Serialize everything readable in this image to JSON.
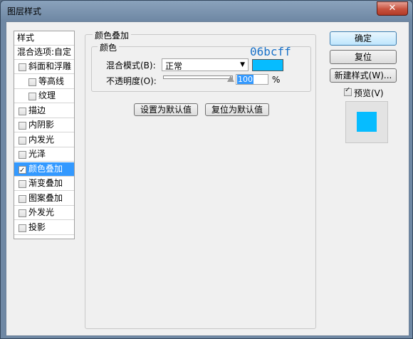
{
  "window": {
    "title": "图层样式",
    "close_label": "✕"
  },
  "style_list": {
    "header": "样式",
    "blend_options": "混合选项:自定",
    "items": [
      {
        "label": "斜面和浮雕",
        "checked": false,
        "selected": false,
        "indent": false
      },
      {
        "label": "等高线",
        "checked": false,
        "selected": false,
        "indent": true
      },
      {
        "label": "纹理",
        "checked": false,
        "selected": false,
        "indent": true
      },
      {
        "label": "描边",
        "checked": false,
        "selected": false,
        "indent": false
      },
      {
        "label": "内阴影",
        "checked": false,
        "selected": false,
        "indent": false
      },
      {
        "label": "内发光",
        "checked": false,
        "selected": false,
        "indent": false
      },
      {
        "label": "光泽",
        "checked": false,
        "selected": false,
        "indent": false
      },
      {
        "label": "颜色叠加",
        "checked": true,
        "selected": true,
        "indent": false
      },
      {
        "label": "渐变叠加",
        "checked": false,
        "selected": false,
        "indent": false
      },
      {
        "label": "图案叠加",
        "checked": false,
        "selected": false,
        "indent": false
      },
      {
        "label": "外发光",
        "checked": false,
        "selected": false,
        "indent": false
      },
      {
        "label": "投影",
        "checked": false,
        "selected": false,
        "indent": false
      }
    ]
  },
  "panel": {
    "title": "颜色叠加",
    "group_title": "颜色",
    "blend_mode_label": "混合模式(B):",
    "blend_mode_value": "正常",
    "opacity_label": "不透明度(O):",
    "opacity_value": "100",
    "opacity_unit": "%",
    "opacity_fraction": 1.0,
    "color_hex_annotation": "06bcff",
    "color": "#06bcff",
    "make_default": "设置为默认值",
    "reset_default": "复位为默认值"
  },
  "buttons": {
    "ok": "确定",
    "reset": "复位",
    "new_style": "新建样式(W)..."
  },
  "preview": {
    "label": "预览(V)",
    "checked": true
  }
}
